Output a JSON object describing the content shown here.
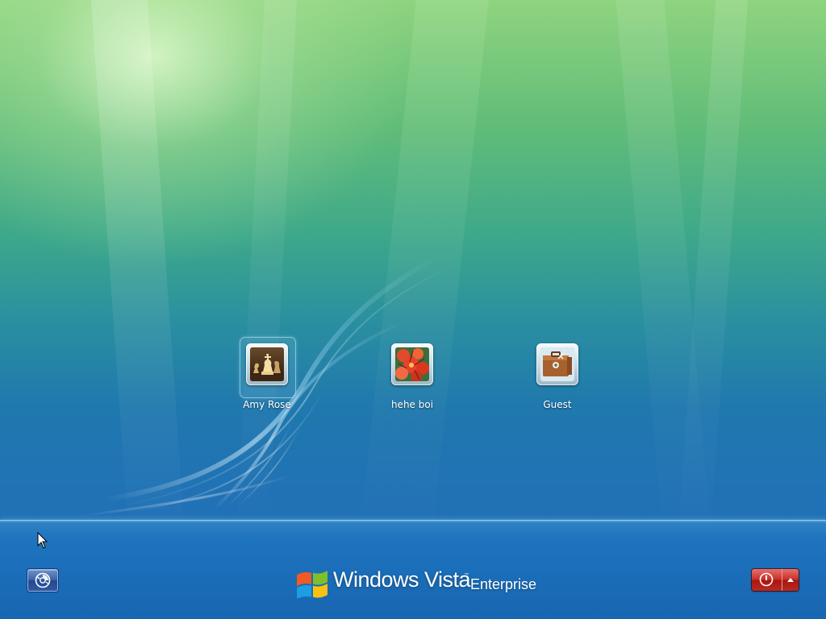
{
  "screen": {
    "type": "Windows Vista logon screen"
  },
  "users": [
    {
      "name": "Amy Rose",
      "picture": "chess-pieces-picture",
      "selected": true
    },
    {
      "name": "hehe boi",
      "picture": "red-flowers-picture",
      "selected": false
    },
    {
      "name": "Guest",
      "picture": "guest-briefcase-picture",
      "selected": false
    }
  ],
  "branding": {
    "product": "Windows Vista",
    "trademark": "™",
    "edition": "Enterprise"
  },
  "controls": {
    "ease_of_access_icon": "ease-of-access-icon",
    "shutdown_icon": "power-icon",
    "shutdown_menu_icon": "arrow-up-icon"
  },
  "colors": {
    "shutdown_red": "#c7312a",
    "ease_blue": "#3c62a6",
    "bar_blue": "#1e74bf"
  }
}
